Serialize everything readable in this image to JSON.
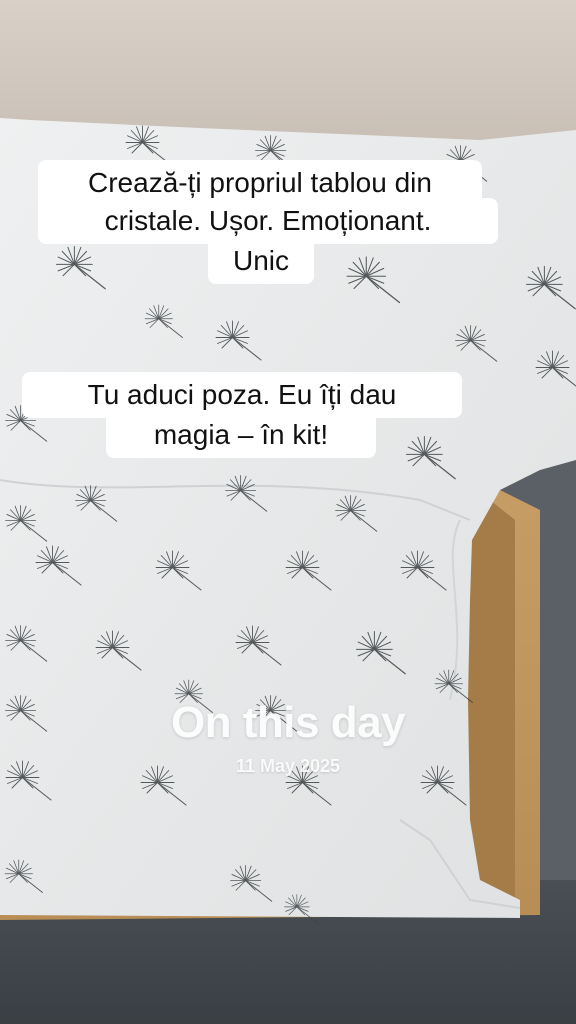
{
  "captions": {
    "first": {
      "line1": "Crează-ți propriul tablou din",
      "line2": "cristale. Ușor. Emoționant.",
      "line3": "Unic"
    },
    "second": {
      "line1": "Tu aduci poza. Eu îți dau",
      "line2": "magia – în kit!"
    }
  },
  "memory": {
    "title": "On this day",
    "date": "11 May 2025"
  },
  "colors": {
    "paper": "#e9ebec",
    "pattern": "#3b3f42",
    "cardboard": "#c09361",
    "caption_bg": "#ffffff"
  },
  "scene": {
    "description_icons": [
      "dandelion-seed-pattern"
    ]
  }
}
